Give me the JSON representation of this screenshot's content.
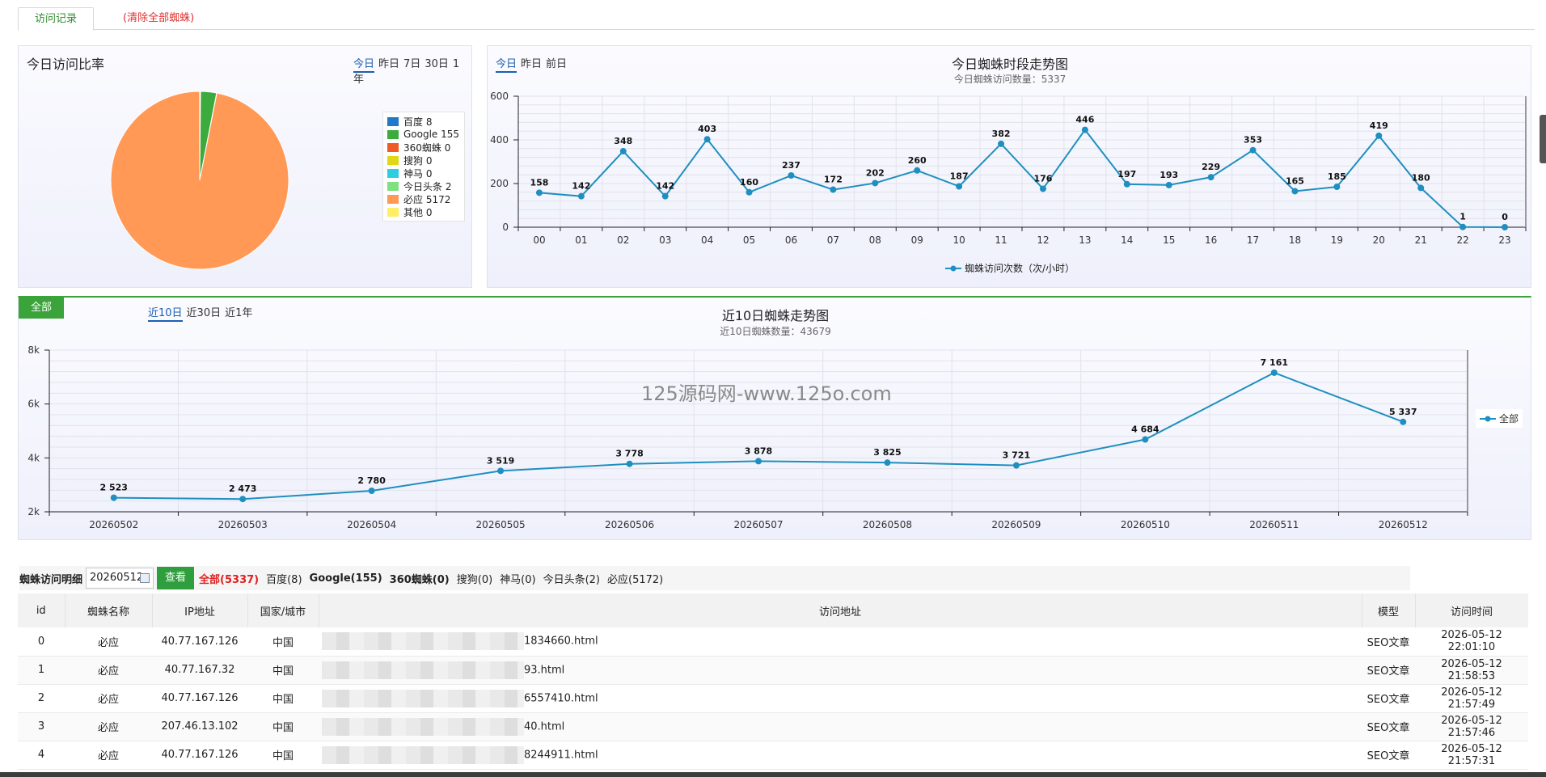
{
  "tabs": {
    "active": "访问记录",
    "clear": "(清除全部蜘蛛)"
  },
  "ratio_panel": {
    "title": "今日访问比率",
    "ranges": [
      "今日",
      "昨日",
      "7日",
      "30日",
      "1年"
    ],
    "legend": [
      {
        "label": "百度 8",
        "color": "#1f78c8"
      },
      {
        "label": "Google 155",
        "color": "#3daa3d"
      },
      {
        "label": "360蜘蛛 0",
        "color": "#f05a24"
      },
      {
        "label": "搜狗 0",
        "color": "#e0d814"
      },
      {
        "label": "神马 0",
        "color": "#2ecde0"
      },
      {
        "label": "今日头条 2",
        "color": "#7fe07f"
      },
      {
        "label": "必应 5172",
        "color": "#ff9955"
      },
      {
        "label": "其他 0",
        "color": "#ffee66"
      }
    ]
  },
  "hourly_panel": {
    "ranges": [
      "今日",
      "昨日",
      "前日"
    ],
    "title": "今日蜘蛛时段走势图",
    "subtitle": "今日蜘蛛访问数量：5337",
    "legend": "蜘蛛访问次数（次/小时）"
  },
  "daily_panel": {
    "all_button": "全部",
    "ranges": [
      "近10日",
      "近30日",
      "近1年"
    ],
    "title": "近10日蜘蛛走势图",
    "subtitle": "近10日蜘蛛数量：43679",
    "legend": "全部",
    "watermark": "125源码网-www.125o.com"
  },
  "chart_data": [
    {
      "type": "pie",
      "categories": [
        "百度",
        "Google",
        "360蜘蛛",
        "搜狗",
        "神马",
        "今日头条",
        "必应",
        "其他"
      ],
      "values": [
        8,
        155,
        0,
        0,
        0,
        2,
        5172,
        0
      ],
      "colors": [
        "#1f78c8",
        "#3daa3d",
        "#f05a24",
        "#e0d814",
        "#2ecde0",
        "#7fe07f",
        "#ff9955",
        "#ffee66"
      ]
    },
    {
      "type": "line",
      "title": "今日蜘蛛时段走势图",
      "subtitle": "今日蜘蛛访问数量：5337",
      "x": [
        "00",
        "01",
        "02",
        "03",
        "04",
        "05",
        "06",
        "07",
        "08",
        "09",
        "10",
        "11",
        "12",
        "13",
        "14",
        "15",
        "16",
        "17",
        "18",
        "19",
        "20",
        "21",
        "22",
        "23"
      ],
      "series": [
        {
          "name": "蜘蛛访问次数（次/小时）",
          "values": [
            158,
            142,
            348,
            142,
            403,
            160,
            237,
            172,
            202,
            260,
            187,
            382,
            176,
            446,
            197,
            193,
            229,
            353,
            165,
            185,
            419,
            180,
            1,
            0
          ]
        }
      ],
      "ylim": [
        0,
        600
      ],
      "yticks": [
        0,
        200,
        400,
        600
      ],
      "color": "#1f8fc0"
    },
    {
      "type": "line",
      "title": "近10日蜘蛛走势图",
      "subtitle": "近10日蜘蛛数量：43679",
      "x": [
        "20260502",
        "20260503",
        "20260504",
        "20260505",
        "20260506",
        "20260507",
        "20260508",
        "20260509",
        "20260510",
        "20260511",
        "20260512"
      ],
      "series": [
        {
          "name": "全部",
          "values": [
            2523,
            2473,
            2780,
            3519,
            3778,
            3878,
            3825,
            3721,
            4684,
            7161,
            5337
          ]
        }
      ],
      "point_labels": [
        "2 523",
        "2 473",
        "2 780",
        "3 519",
        "3 778",
        "3 878",
        "3 825",
        "3 721",
        "4 684",
        "7 161",
        "5 337"
      ],
      "ylim": [
        2000,
        8000
      ],
      "yticks": [
        "2k",
        "4k",
        "6k",
        "8k"
      ],
      "color": "#1f8fc0"
    }
  ],
  "filter": {
    "label": "蜘蛛访问明细",
    "date": "20260512",
    "view_button": "查看",
    "items": [
      "全部(5337)",
      "百度(8)",
      "Google(155)",
      "360蜘蛛(0)",
      "搜狗(0)",
      "神马(0)",
      "今日头条(2)",
      "必应(5172)"
    ]
  },
  "table": {
    "headers": [
      "id",
      "蜘蛛名称",
      "IP地址",
      "国家/城市",
      "访问地址",
      "模型",
      "访问时间"
    ],
    "rows": [
      {
        "id": "0",
        "name": "必应",
        "ip": "40.77.167.126",
        "city": "中国",
        "url": "1834660.html",
        "model": "SEO文章",
        "time": "2026-05-12 22:01:10"
      },
      {
        "id": "1",
        "name": "必应",
        "ip": "40.77.167.32",
        "city": "中国",
        "url": "93.html",
        "model": "SEO文章",
        "time": "2026-05-12 21:58:53"
      },
      {
        "id": "2",
        "name": "必应",
        "ip": "40.77.167.126",
        "city": "中国",
        "url": "6557410.html",
        "model": "SEO文章",
        "time": "2026-05-12 21:57:49"
      },
      {
        "id": "3",
        "name": "必应",
        "ip": "207.46.13.102",
        "city": "中国",
        "url": "40.html",
        "model": "SEO文章",
        "time": "2026-05-12 21:57:46"
      },
      {
        "id": "4",
        "name": "必应",
        "ip": "40.77.167.126",
        "city": "中国",
        "url": "8244911.html",
        "model": "SEO文章",
        "time": "2026-05-12 21:57:31"
      }
    ]
  }
}
